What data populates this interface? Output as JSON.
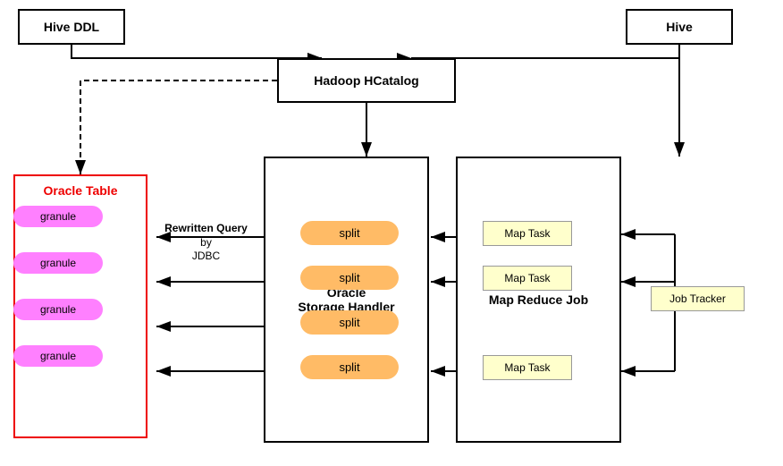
{
  "boxes": {
    "hive_ddl": {
      "label": "Hive DDL"
    },
    "hive": {
      "label": "Hive"
    },
    "hadoop": {
      "label": "Hadoop HCatalog"
    },
    "oracle_table": {
      "label": "Oracle Table"
    },
    "oracle_storage": {
      "label": "Oracle\nStorage Handler"
    },
    "map_reduce": {
      "label": "Map Reduce Job"
    }
  },
  "granules": [
    "granule",
    "granule",
    "granule",
    "granule"
  ],
  "splits": [
    "split",
    "split",
    "split",
    "split"
  ],
  "map_tasks": [
    "Map Task",
    "Map Task",
    "Map Task"
  ],
  "job_tracker": "Job Tracker",
  "rewritten_query": {
    "bold": "Rewritten Query",
    "normal": " by\nJDBC"
  }
}
